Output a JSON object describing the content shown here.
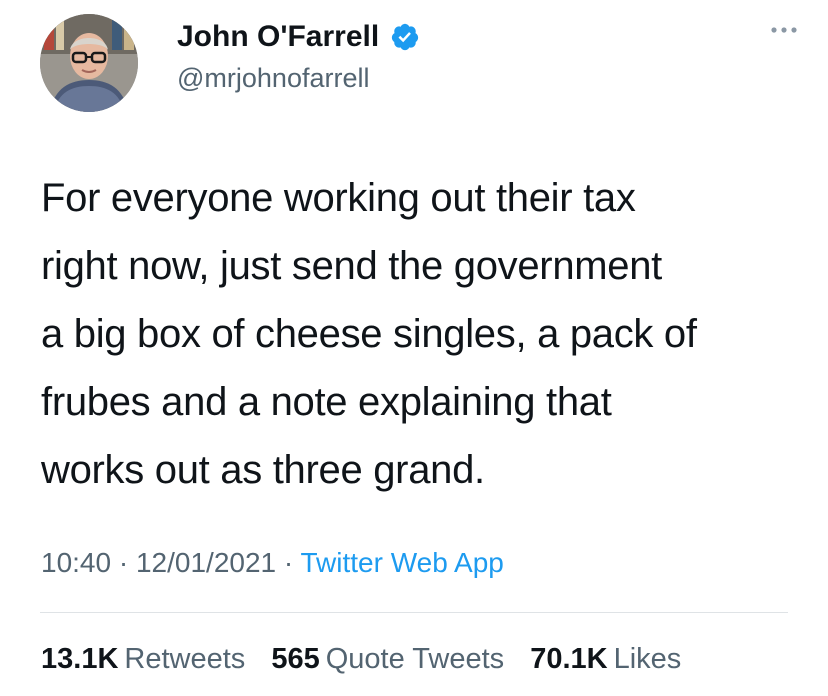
{
  "author": {
    "display_name": "John O'Farrell",
    "handle": "@mrjohnofarrell",
    "verified": true,
    "avatar_icon": "person-avatar"
  },
  "tweet": {
    "lines": [
      "For everyone working out their tax",
      "right now, just send the government",
      "a big box of cheese singles, a pack of",
      "frubes and a note explaining that",
      "works out as three grand."
    ]
  },
  "meta": {
    "time": "10:40",
    "separator": " · ",
    "date": "12/01/2021",
    "source": "Twitter Web App"
  },
  "stats": {
    "retweets_count": "13.1K",
    "retweets_label": "Retweets",
    "quotes_count": "565",
    "quotes_label": "Quote Tweets",
    "likes_count": "70.1K",
    "likes_label": "Likes"
  },
  "colors": {
    "text": "#0f1419",
    "secondary": "#536471",
    "link": "#1d9bf0",
    "verified": "#1d9bf0"
  }
}
